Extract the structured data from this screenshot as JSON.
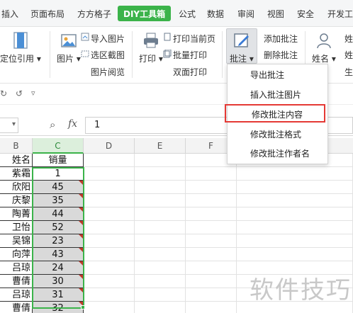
{
  "menubar": {
    "tabs": [
      {
        "label": "插入",
        "active": false
      },
      {
        "label": "页面布局",
        "active": false
      },
      {
        "label": "方方格子",
        "active": false
      },
      {
        "label": "DIY工具箱",
        "active": true
      },
      {
        "label": "公式",
        "active": false
      },
      {
        "label": "数据",
        "active": false
      },
      {
        "label": "审阅",
        "active": false
      },
      {
        "label": "视图",
        "active": false
      },
      {
        "label": "安全",
        "active": false
      },
      {
        "label": "开发工",
        "active": false
      }
    ],
    "active_color": "#3bb34a"
  },
  "ribbon": {
    "locate_ref": "定位引用",
    "picture": "图片",
    "import_picture": "导入图片",
    "select_area_screenshot": "选区截图",
    "picture_browse": "图片阅览",
    "print": "打印",
    "print_current_page": "打印当前页",
    "batch_print": "批量打印",
    "duplex_print": "双面打印",
    "comment": "批注",
    "add_comment": "添加批注",
    "delete_comment": "删除批注",
    "name": "姓名",
    "name_partial_1": "姓",
    "name_partial_2": "姓",
    "name_partial_3": "生"
  },
  "formula_bar": {
    "zoom_icon": "magnifier-icon",
    "fx_label": "fx",
    "value": "1"
  },
  "columns": [
    "B",
    "C",
    "D",
    "E",
    "F"
  ],
  "rows": [
    {
      "b": "姓名",
      "c": "销量"
    },
    {
      "b": "紫霜",
      "c": "1"
    },
    {
      "b": "欣阳",
      "c": "45"
    },
    {
      "b": "庆黎",
      "c": "35"
    },
    {
      "b": "陶菁",
      "c": "44"
    },
    {
      "b": "卫怡",
      "c": "52"
    },
    {
      "b": "吴锦",
      "c": "23"
    },
    {
      "b": "向萍",
      "c": "43"
    },
    {
      "b": "吕琼",
      "c": "24"
    },
    {
      "b": "曹倩",
      "c": "30"
    },
    {
      "b": "吕琼",
      "c": "31"
    },
    {
      "b": "曹倩",
      "c": "32"
    }
  ],
  "dropdown": {
    "items": [
      {
        "label": "导出批注",
        "highlighted": false
      },
      {
        "label": "插入批注图片",
        "highlighted": false
      },
      {
        "label": "修改批注内容",
        "highlighted": true
      },
      {
        "label": "修改批注格式",
        "highlighted": false
      },
      {
        "label": "修改批注作者名",
        "highlighted": false
      }
    ],
    "highlight_color": "#e53935"
  },
  "watermark": "软件技巧"
}
